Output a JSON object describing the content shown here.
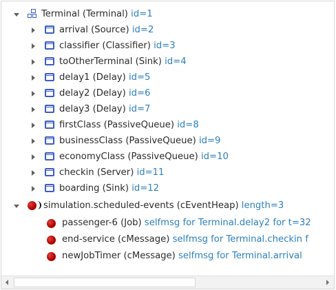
{
  "tree": {
    "root": {
      "icon": "network-icon",
      "text": "Terminal (Terminal)",
      "info": "id=1"
    },
    "submodules": [
      {
        "icon": "module-icon",
        "text": "arrival (Source)",
        "info": "id=2"
      },
      {
        "icon": "module-icon",
        "text": "classifier (Classifier)",
        "info": "id=3"
      },
      {
        "icon": "module-icon",
        "text": "toOtherTerminal (Sink)",
        "info": "id=4"
      },
      {
        "icon": "module-icon",
        "text": "delay1 (Delay)",
        "info": "id=5"
      },
      {
        "icon": "module-icon",
        "text": "delay2 (Delay)",
        "info": "id=6"
      },
      {
        "icon": "module-icon",
        "text": "delay3 (Delay)",
        "info": "id=7"
      },
      {
        "icon": "module-icon",
        "text": "firstClass (PassiveQueue)",
        "info": "id=8"
      },
      {
        "icon": "module-icon",
        "text": "businessClass (PassiveQueue)",
        "info": "id=9"
      },
      {
        "icon": "module-icon",
        "text": "economyClass (PassiveQueue)",
        "info": "id=10"
      },
      {
        "icon": "module-icon",
        "text": "checkin (Server)",
        "info": "id=11"
      },
      {
        "icon": "module-icon",
        "text": "boarding (Sink)",
        "info": "id=12"
      }
    ],
    "heap": {
      "icon": "event-heap-icon",
      "text": "simulation.scheduled-events (cEventHeap)",
      "info": "length=3"
    },
    "events": [
      {
        "icon": "message-icon",
        "text": "passenger-6 (Job)",
        "info": "selfmsg for Terminal.delay2 for t=32"
      },
      {
        "icon": "message-icon",
        "text": "end-service (cMessage)",
        "info": "selfmsg for Terminal.checkin f"
      },
      {
        "icon": "message-icon",
        "text": "newJobTimer (cMessage)",
        "info": "selfmsg for Terminal.arrival"
      }
    ]
  },
  "scrollbar": {
    "left_icon": "scroll-left-icon",
    "right_icon": "scroll-right-icon"
  },
  "colors": {
    "text": "#2b2b2b",
    "info": "#2d7fbf",
    "module_icon": "#3c5cc4",
    "message_icon": "#b00000"
  }
}
